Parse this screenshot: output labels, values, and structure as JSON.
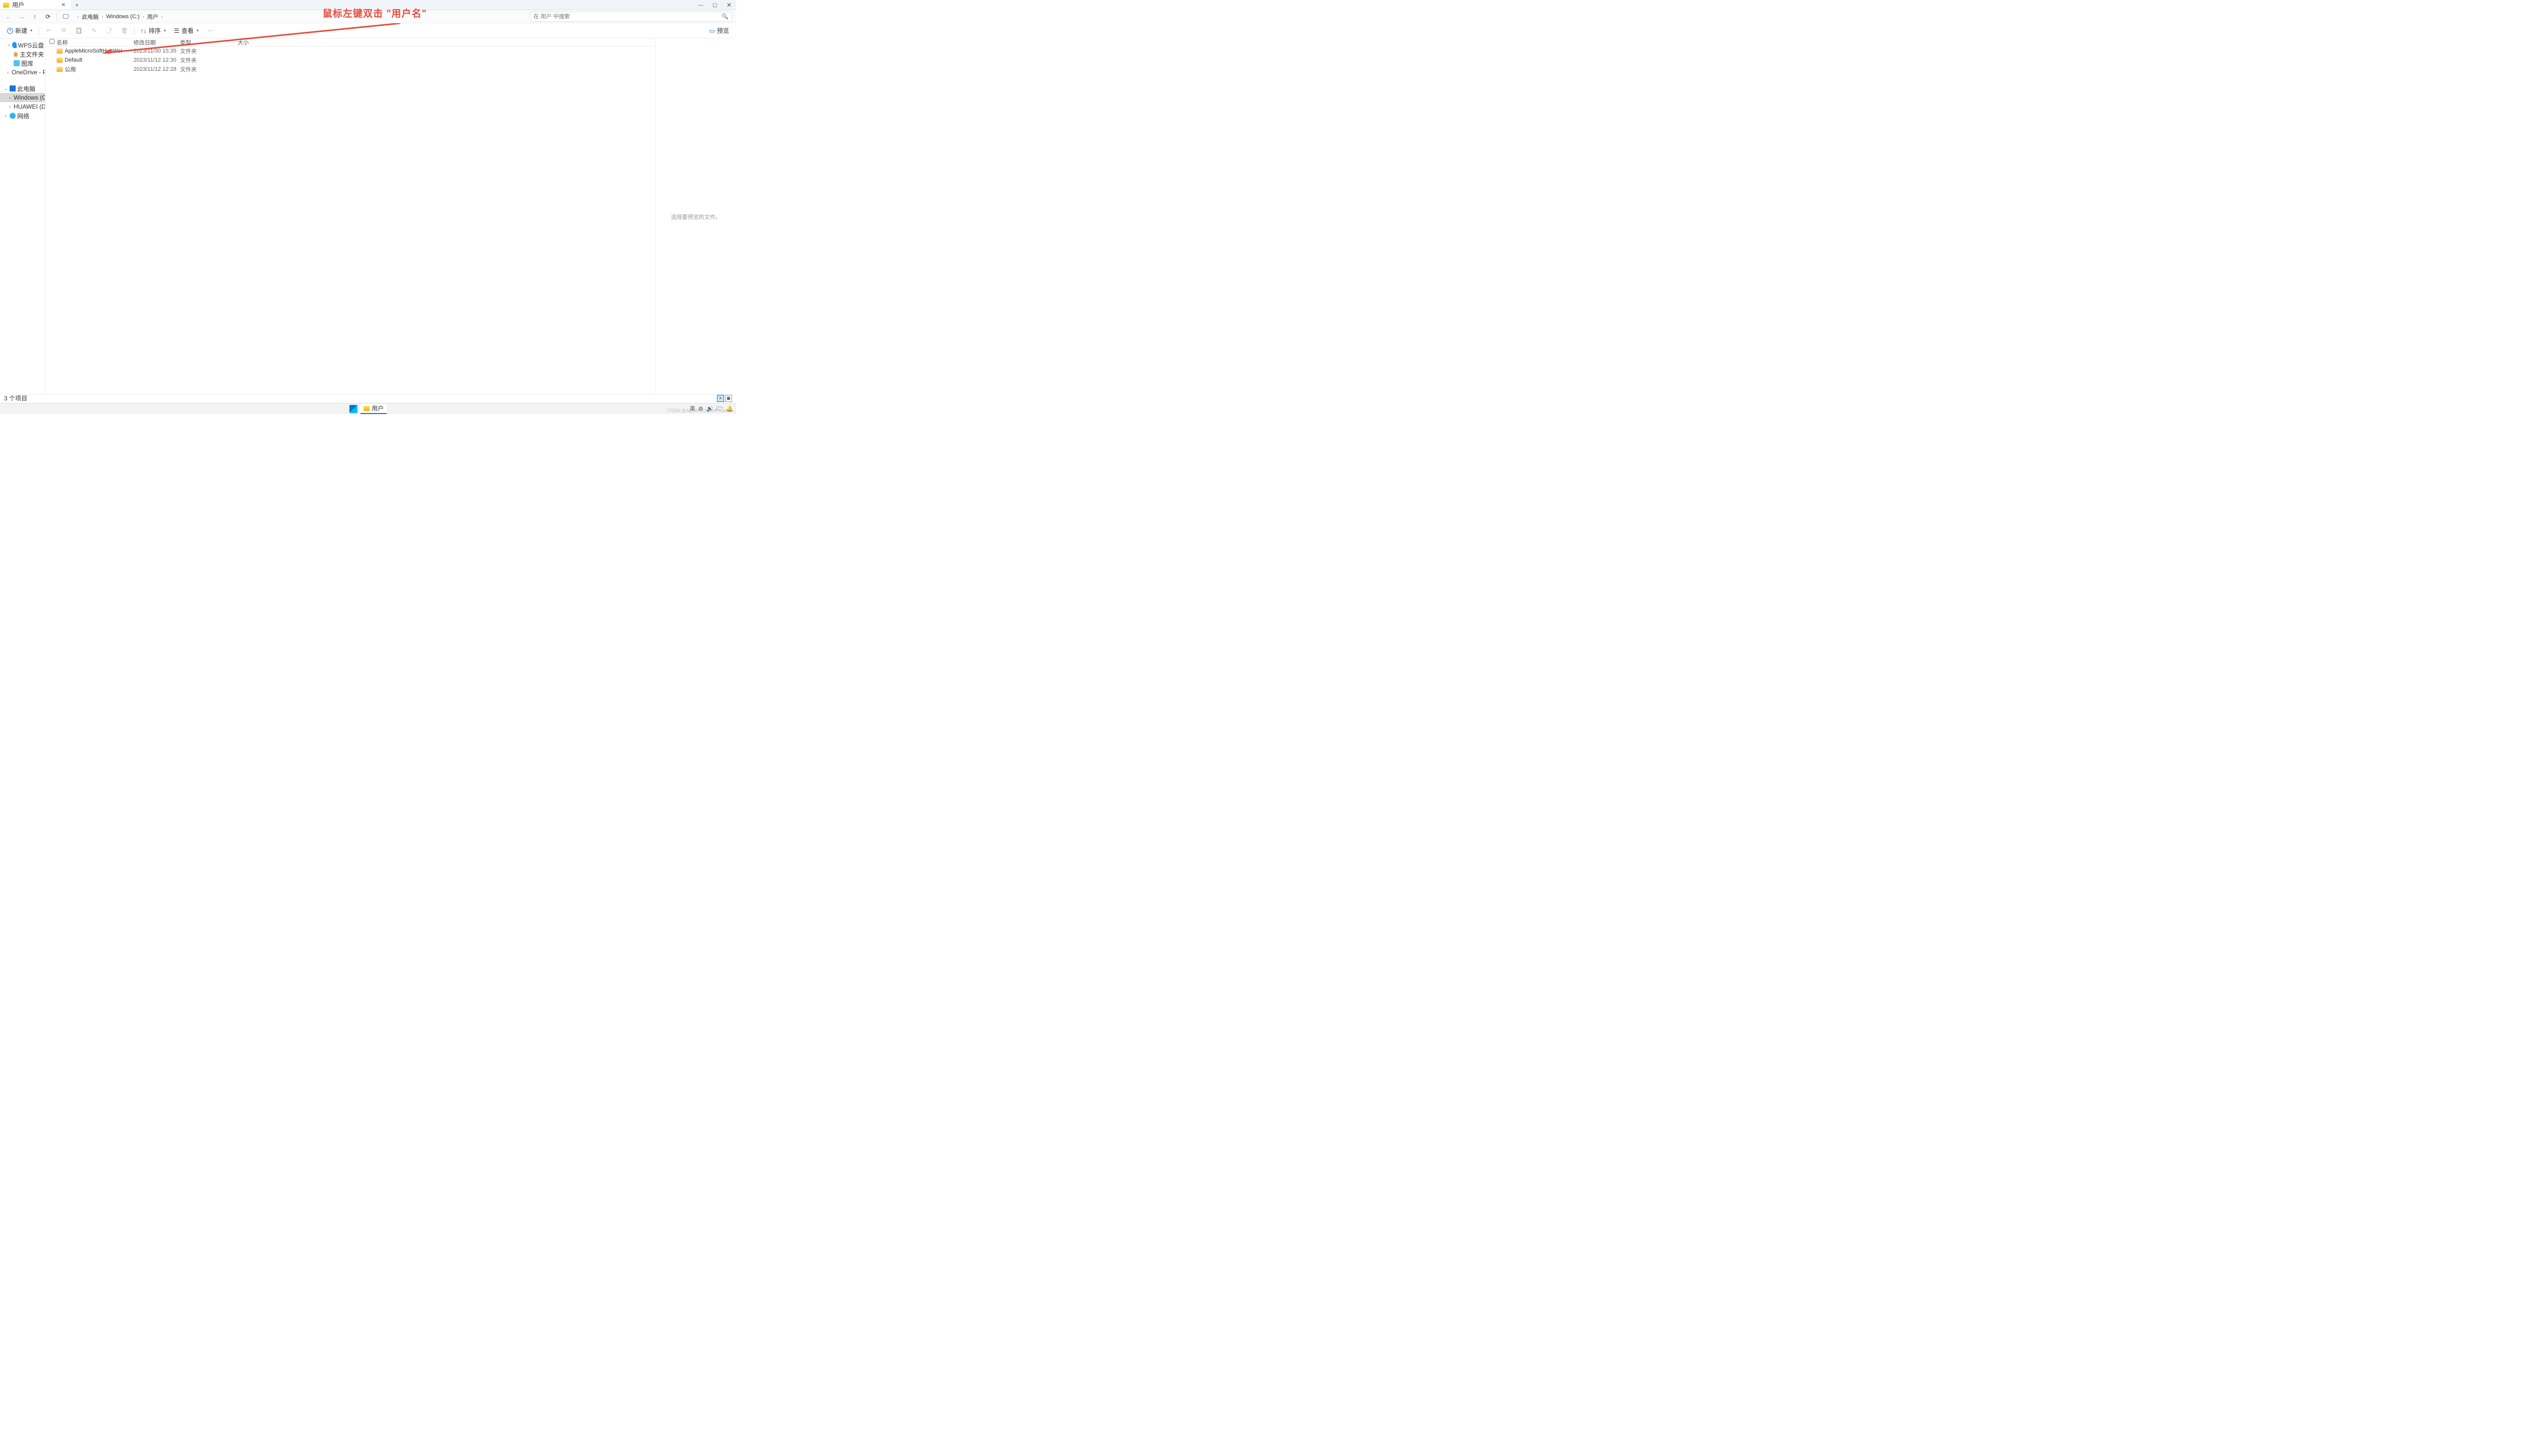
{
  "tab": {
    "title": "用户"
  },
  "window_controls": {
    "min": "—",
    "max": "▢",
    "close": "✕"
  },
  "nav": {
    "back": "←",
    "forward": "→",
    "up": "↑",
    "refresh": "⟳",
    "monitor": "🖵",
    "crumbs": [
      "此电脑",
      "Windows (C:)",
      "用户"
    ]
  },
  "search": {
    "placeholder": "在 用户 中搜索"
  },
  "toolbar": {
    "new": "新建",
    "cut": "✂",
    "copy": "⧉",
    "paste": "📋",
    "rename": "✎",
    "share": "⤴",
    "delete": "🗑",
    "sort": "排序",
    "sort_ico": "↑↓",
    "view": "查看",
    "view_ico": "☰",
    "more": "⋯",
    "preview": "预览",
    "preview_ico": "▭"
  },
  "columns": {
    "name": "名称",
    "modified": "修改日期",
    "type": "类型",
    "size": "大小"
  },
  "files": [
    {
      "name": "AppleMicroSoftHuaWei",
      "date": "2023/11/30 15:35",
      "type": "文件夹"
    },
    {
      "name": "Default",
      "date": "2023/11/12 12:30",
      "type": "文件夹"
    },
    {
      "name": "公用",
      "date": "2023/11/12 12:28",
      "type": "文件夹"
    }
  ],
  "sidebar": {
    "items": [
      {
        "expand": "›",
        "icon": "ico-cloud",
        "label": "WPS云盘",
        "indent": "indent1"
      },
      {
        "expand": "",
        "icon": "ico-home",
        "label": "主文件夹",
        "indent": "indent1"
      },
      {
        "expand": "",
        "icon": "ico-lib",
        "label": "图库",
        "indent": "indent1"
      },
      {
        "expand": "›",
        "icon": "ico-onedrive",
        "label": "OneDrive - Person",
        "indent": "indent1"
      },
      {
        "separator": true
      },
      {
        "expand": "⌄",
        "icon": "ico-pc",
        "label": "此电脑",
        "indent": ""
      },
      {
        "expand": "›",
        "icon": "ico-disk",
        "label": "Windows (C:)",
        "indent": "indent2",
        "selected": true
      },
      {
        "expand": "›",
        "icon": "ico-disk-dark",
        "label": "HUAWEI (D:)",
        "indent": "indent2"
      },
      {
        "expand": "›",
        "icon": "ico-net",
        "label": "网络",
        "indent": ""
      }
    ]
  },
  "preview_pane": {
    "message": "选择要预览的文件。"
  },
  "status": {
    "text": "3 个项目"
  },
  "taskbar": {
    "explorer": "用户"
  },
  "tray": {
    "ime": "英",
    "wifi": "⚙",
    "vol": "🔊",
    "bat": "🗁",
    "bell": "🔔"
  },
  "annotation": {
    "text": "鼠标左键双击 \"用户名\""
  },
  "watermark": "CSDN @AppleMicroSoftHuaWei"
}
